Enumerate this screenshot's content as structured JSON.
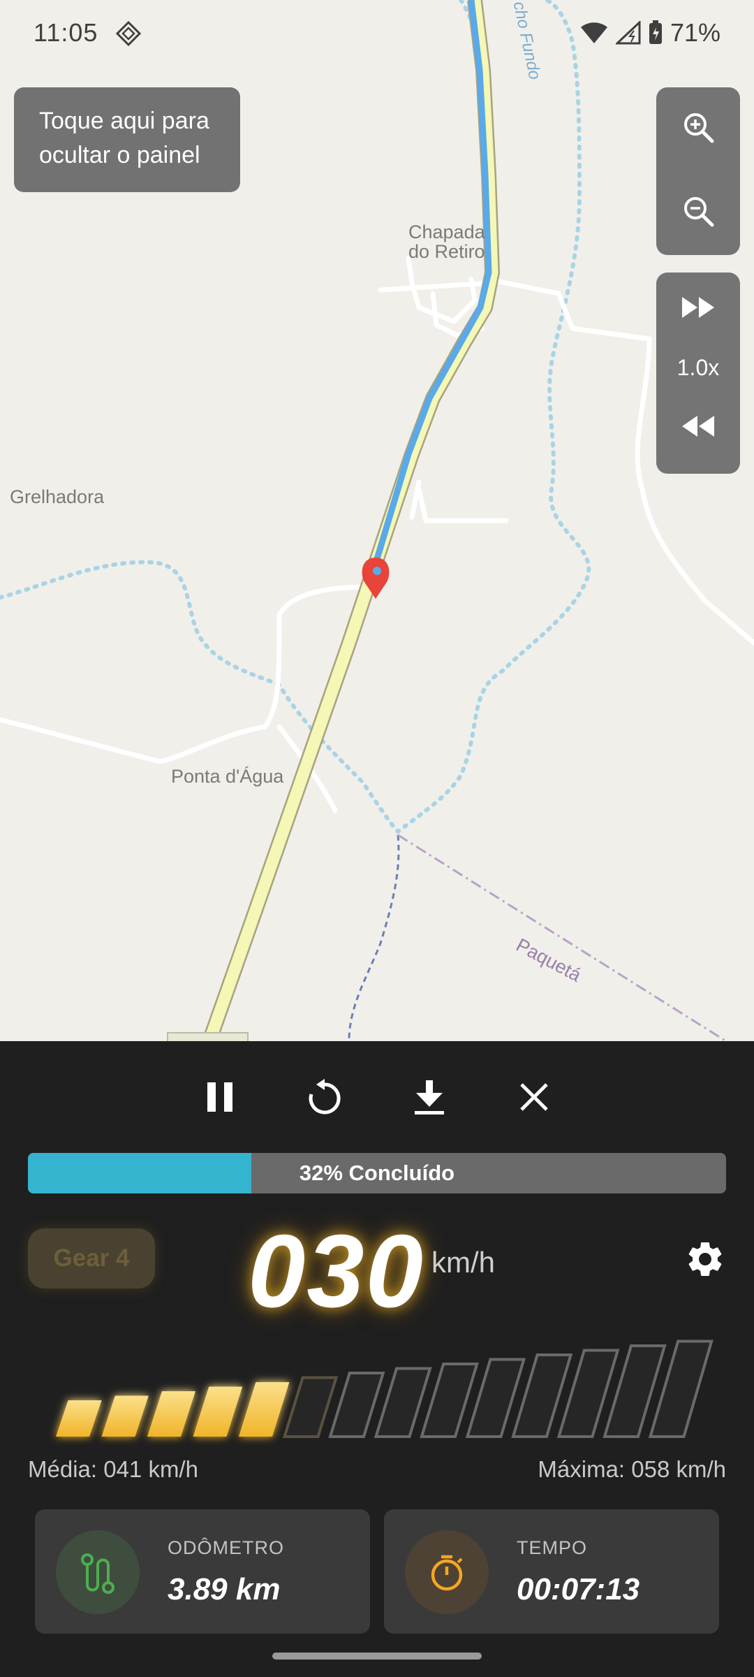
{
  "status_bar": {
    "time": "11:05",
    "battery": "71%"
  },
  "map": {
    "labels": {
      "chapada": "Chapada\ndo Retiro",
      "grelhadora": "Grelhadora",
      "ponta": "Ponta d'Água",
      "paqueta": "Paquetá",
      "riacho": "cho Fundo"
    }
  },
  "hint_button": {
    "label": "Toque aqui para ocultar o painel"
  },
  "zoom": {
    "in_icon": "zoom-in-icon",
    "out_icon": "zoom-out-icon"
  },
  "playback_speed": {
    "label": "1.0x",
    "forward_icon": "fast-forward-icon",
    "rewind_icon": "rewind-icon"
  },
  "controls": {
    "icons": [
      "pause-icon",
      "replay-icon",
      "download-icon",
      "close-icon"
    ]
  },
  "progress": {
    "percent": 32,
    "label": "32% Concluído",
    "color": "#35b4d0"
  },
  "gear": {
    "label": "Gear 4"
  },
  "speedometer": {
    "speed": "030",
    "unit": "km/h",
    "level_bars_lit": 5,
    "level_bars_total": 14
  },
  "stats": {
    "average": "Média: 041 km/h",
    "maximum": "Máxima: 058 km/h"
  },
  "cards": {
    "odometer": {
      "label": "ODÔMETRO",
      "value": "3.89 km",
      "accent": "#4caf50"
    },
    "time": {
      "label": "TEMPO",
      "value": "00:07:13",
      "accent": "#f5a623"
    }
  }
}
